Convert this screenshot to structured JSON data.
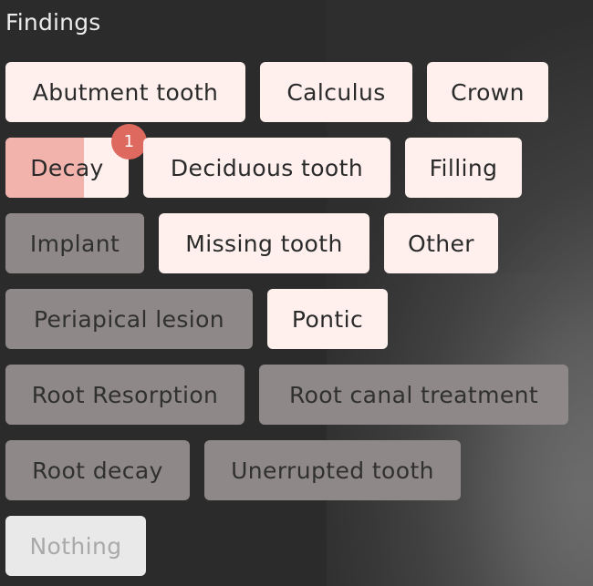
{
  "panel": {
    "title": "Findings"
  },
  "findings": [
    {
      "label": "Abutment tooth",
      "state": "active"
    },
    {
      "label": "Calculus",
      "state": "active"
    },
    {
      "label": "Crown",
      "state": "active"
    },
    {
      "label": "Decay",
      "state": "active",
      "badge": "1",
      "fill_fraction": 0.64
    },
    {
      "label": "Deciduous tooth",
      "state": "active"
    },
    {
      "label": "Filling",
      "state": "active"
    },
    {
      "label": "Implant",
      "state": "inactive"
    },
    {
      "label": "Missing tooth",
      "state": "active"
    },
    {
      "label": "Other",
      "state": "active"
    },
    {
      "label": "Periapical lesion",
      "state": "inactive"
    },
    {
      "label": "Pontic",
      "state": "active"
    },
    {
      "label": "Root Resorption",
      "state": "inactive"
    },
    {
      "label": "Root canal treatment",
      "state": "inactive"
    },
    {
      "label": "Root decay",
      "state": "inactive"
    },
    {
      "label": "Unerrupted tooth",
      "state": "inactive"
    },
    {
      "label": "Nothing",
      "state": "disabled"
    }
  ],
  "colors": {
    "active_bg": "#fff0ee",
    "inactive_bg": "#8f8888",
    "disabled_bg": "#e9e9e9",
    "badge": "#de6a5f",
    "decay_fill": "#f2b3ad"
  }
}
